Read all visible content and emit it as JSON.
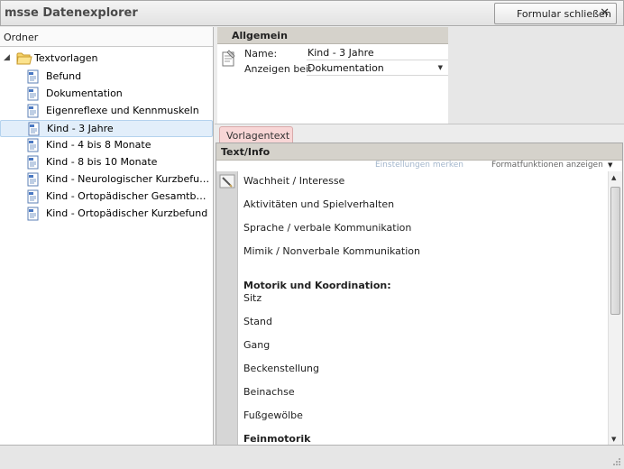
{
  "app": {
    "title": "msse Datenexplorer",
    "close_button_label": "Formular schließen",
    "close_symbol": "✕"
  },
  "left_panel": {
    "header": "Ordner",
    "root": {
      "label": "Textvorlagen",
      "expand_symbol": "◢"
    },
    "items": [
      {
        "label": "Befund"
      },
      {
        "label": "Dokumentation"
      },
      {
        "label": "Eigenreflexe und Kennmuskeln"
      },
      {
        "label": "Kind - 3 Jahre",
        "selected": true
      },
      {
        "label": "Kind - 4 bis 8 Monate"
      },
      {
        "label": "Kind - 8 bis 10 Monate"
      },
      {
        "label": "Kind - Neurologischer Kurzbefund"
      },
      {
        "label": "Kind - Ortopädischer Gesamtbefund"
      },
      {
        "label": "Kind - Ortopädischer Kurzbefund"
      }
    ]
  },
  "allgemein": {
    "header": "Allgemein",
    "name_label": "Name:",
    "name_value": "Kind - 3 Jahre",
    "show_label": "Anzeigen bei:",
    "show_value": "Dokumentation",
    "dropdown_symbol": "▼"
  },
  "tab": {
    "label": "Vorlagentext"
  },
  "text_panel": {
    "header": "Text/Info",
    "settings_link": "Einstellungen merken",
    "format_link": "Formatfunktionen anzeigen",
    "dropdown_symbol": "▼",
    "scroll_up": "▲",
    "scroll_down": "▼",
    "lines": [
      {
        "text": "Wachheit / Interesse",
        "bold": false
      },
      {
        "text": "Aktivitäten und Spielverhalten",
        "bold": false
      },
      {
        "text": "Sprache / verbale Kommunikation",
        "bold": false
      },
      {
        "text": "Mimik / Nonverbale Kommunikation",
        "bold": false
      },
      {
        "text": "Motorik und Koordination:",
        "bold": true
      },
      {
        "text": "Sitz",
        "bold": false
      },
      {
        "text": "Stand",
        "bold": false
      },
      {
        "text": "Gang",
        "bold": false
      },
      {
        "text": "Beckenstellung",
        "bold": false
      },
      {
        "text": "Beinachse",
        "bold": false
      },
      {
        "text": "Fußgewölbe",
        "bold": false
      },
      {
        "text": "Feinmotorik",
        "bold": true
      }
    ]
  },
  "colors": {
    "tab_bg": "#f8d6d6",
    "header_bg": "#d5d2cb",
    "selection_bg": "#e2eefa",
    "settings_link": "#a3b6cc"
  },
  "icons": {
    "folder": "folder-icon",
    "template": "template-doc-icon",
    "form": "form-icon",
    "edit": "pencil-icon",
    "close": "close-icon"
  }
}
